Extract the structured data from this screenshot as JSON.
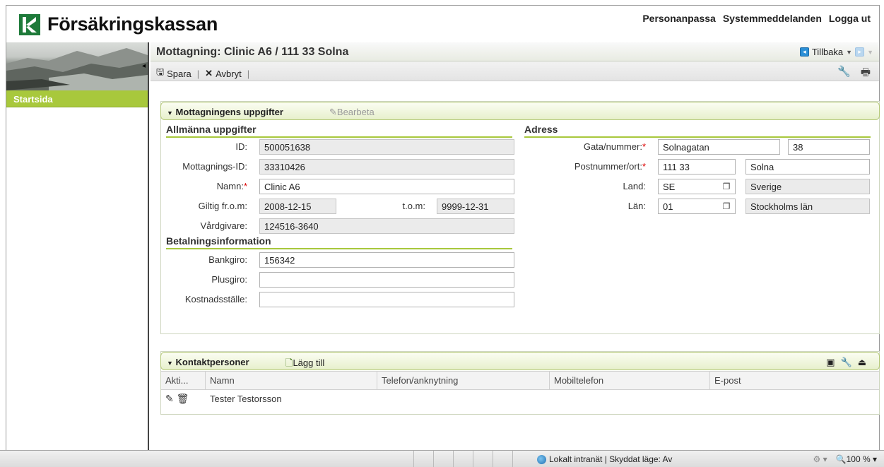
{
  "header": {
    "logo_text": "Försäkringskassan",
    "nav": [
      "Personanpassa",
      "Systemmeddelanden",
      "Logga ut"
    ]
  },
  "sidebar": {
    "items": [
      {
        "label": "Startsida"
      }
    ]
  },
  "page": {
    "title": "Mottagning: Clinic A6 / 111 33 Solna",
    "back_label": "Tillbaka"
  },
  "toolbar": {
    "save_label": "Spara",
    "cancel_label": "Avbryt"
  },
  "details_panel": {
    "title": "Mottagningens uppgifter",
    "edit_label": "Bearbeta",
    "general": {
      "title": "Allmänna uppgifter",
      "id_label": "ID:",
      "id_value": "500051638",
      "mottagnings_id_label": "Mottagnings-ID:",
      "mottagnings_id_value": "33310426",
      "namn_label": "Namn:",
      "namn_value": "Clinic A6",
      "giltig_from_label": "Giltig fr.o.m:",
      "giltig_from_value": "2008-12-15",
      "tom_label": "t.o.m:",
      "tom_value": "9999-12-31",
      "vardgivare_label": "Vårdgivare:",
      "vardgivare_value": "124516-3640"
    },
    "payment": {
      "title": "Betalningsinformation",
      "bankgiro_label": "Bankgiro:",
      "bankgiro_value": "156342",
      "plusgiro_label": "Plusgiro:",
      "plusgiro_value": "",
      "kostnadsstalle_label": "Kostnadsställe:",
      "kostnadsstalle_value": ""
    },
    "address": {
      "title": "Adress",
      "gata_label": "Gata/nummer:",
      "gata_value": "Solnagatan",
      "nummer_value": "38",
      "postnummer_label": "Postnummer/ort:",
      "postnummer_value": "111 33",
      "ort_value": "Solna",
      "land_label": "Land:",
      "land_code": "SE",
      "land_name": "Sverige",
      "lan_label": "Län:",
      "lan_code": "01",
      "lan_name": "Stockholms län"
    }
  },
  "contacts_panel": {
    "title": "Kontaktpersoner",
    "add_label": "Lägg till",
    "columns": [
      "Akti...",
      "Namn",
      "Telefon/anknytning",
      "Mobiltelefon",
      "E-post"
    ],
    "rows": [
      {
        "namn": "Tester Testorsson",
        "telefon": "",
        "mobil": "",
        "epost": ""
      }
    ]
  },
  "statusbar": {
    "zone_text": "Lokalt intranät | Skyddat läge: Av",
    "zoom_text": "100 %"
  }
}
